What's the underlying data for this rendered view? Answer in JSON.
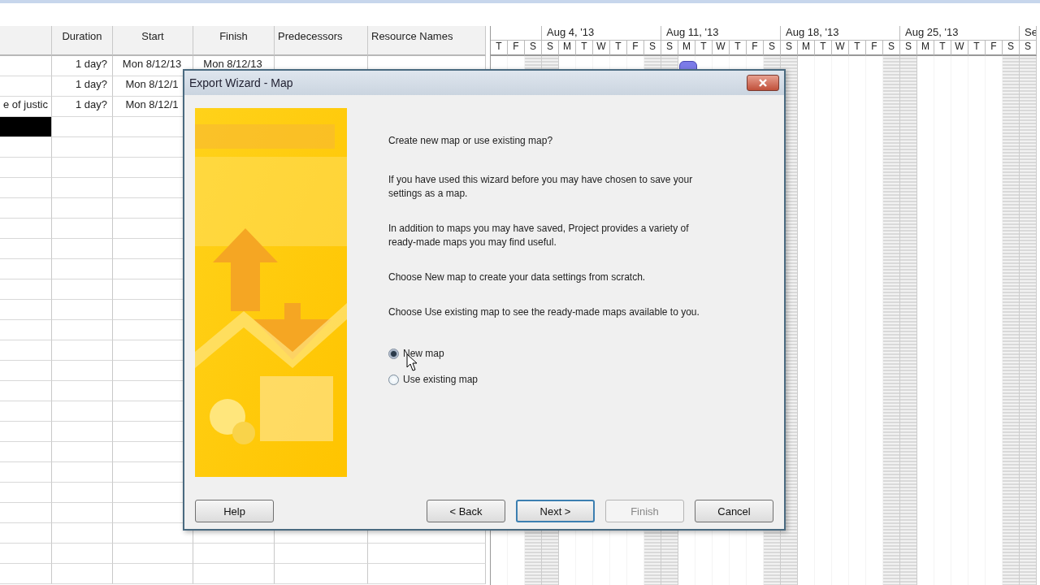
{
  "table": {
    "columns": [
      {},
      {
        "label": "Duration"
      },
      {
        "label": "Start"
      },
      {
        "label": "Finish"
      },
      {
        "label": "Predecessors"
      },
      {
        "label": "Resource Names"
      }
    ],
    "rows": [
      {
        "selected": false,
        "cells": [
          "",
          "1 day?",
          "Mon 8/12/13",
          "Mon 8/12/13",
          "",
          ""
        ]
      },
      {
        "selected": false,
        "cells": [
          "",
          "1 day?",
          "Mon 8/12/1",
          "",
          "",
          ""
        ]
      },
      {
        "selected": false,
        "cells": [
          "e of justic",
          "1 day?",
          "Mon 8/12/1",
          "",
          "",
          ""
        ]
      },
      {
        "selected": true,
        "cells": [
          "",
          "",
          "",
          "",
          "",
          ""
        ]
      }
    ]
  },
  "gantt": {
    "weeks": [
      {
        "days": [
          {
            "letter": "T",
            "weekend": false
          },
          {
            "letter": "F",
            "weekend": false
          },
          {
            "letter": "S",
            "weekend": true
          }
        ]
      },
      {
        "label": "Aug 4, '13",
        "days": [
          {
            "letter": "S",
            "weekend": true
          },
          {
            "letter": "M",
            "weekend": false
          },
          {
            "letter": "T",
            "weekend": false
          },
          {
            "letter": "W",
            "weekend": false
          },
          {
            "letter": "T",
            "weekend": false
          },
          {
            "letter": "F",
            "weekend": false
          },
          {
            "letter": "S",
            "weekend": true
          }
        ]
      },
      {
        "label": "Aug 11, '13",
        "days": [
          {
            "letter": "S",
            "weekend": true
          },
          {
            "letter": "M",
            "weekend": false
          },
          {
            "letter": "T",
            "weekend": false
          },
          {
            "letter": "W",
            "weekend": false
          },
          {
            "letter": "T",
            "weekend": false
          },
          {
            "letter": "F",
            "weekend": false
          },
          {
            "letter": "S",
            "weekend": true
          }
        ]
      },
      {
        "label": "Aug 18, '13",
        "days": [
          {
            "letter": "S",
            "weekend": true
          },
          {
            "letter": "M",
            "weekend": false
          },
          {
            "letter": "T",
            "weekend": false
          },
          {
            "letter": "W",
            "weekend": false
          },
          {
            "letter": "T",
            "weekend": false
          },
          {
            "letter": "F",
            "weekend": false
          },
          {
            "letter": "S",
            "weekend": true
          }
        ]
      },
      {
        "label": "Aug 25, '13",
        "days": [
          {
            "letter": "S",
            "weekend": true
          },
          {
            "letter": "M",
            "weekend": false
          },
          {
            "letter": "T",
            "weekend": false
          },
          {
            "letter": "W",
            "weekend": false
          },
          {
            "letter": "T",
            "weekend": false
          },
          {
            "letter": "F",
            "weekend": false
          },
          {
            "letter": "S",
            "weekend": true
          }
        ]
      },
      {
        "label": "Se",
        "days": [
          {
            "letter": "S",
            "weekend": true
          }
        ]
      }
    ]
  },
  "dialog": {
    "title": "Export Wizard - Map",
    "paragraphs": [
      "Create new map or use existing map?",
      "If you have used this wizard before you may have chosen to save your settings as a map.",
      "In addition to maps you may have saved, Project provides a variety of ready-made maps you may find useful.",
      "Choose New map to create your data settings from scratch.",
      "Choose Use existing map to see the ready-made maps available to you."
    ],
    "options": [
      {
        "label": "New map",
        "selected": true
      },
      {
        "label": "Use existing map",
        "selected": false
      }
    ],
    "buttons": [
      {
        "label": "Help",
        "disabled": false,
        "default": false
      },
      {
        "label": "< Back",
        "disabled": false,
        "default": false
      },
      {
        "label": "Next >",
        "disabled": false,
        "default": true
      },
      {
        "label": "Finish",
        "disabled": true,
        "default": false
      },
      {
        "label": "Cancel",
        "disabled": false,
        "default": false
      }
    ]
  }
}
